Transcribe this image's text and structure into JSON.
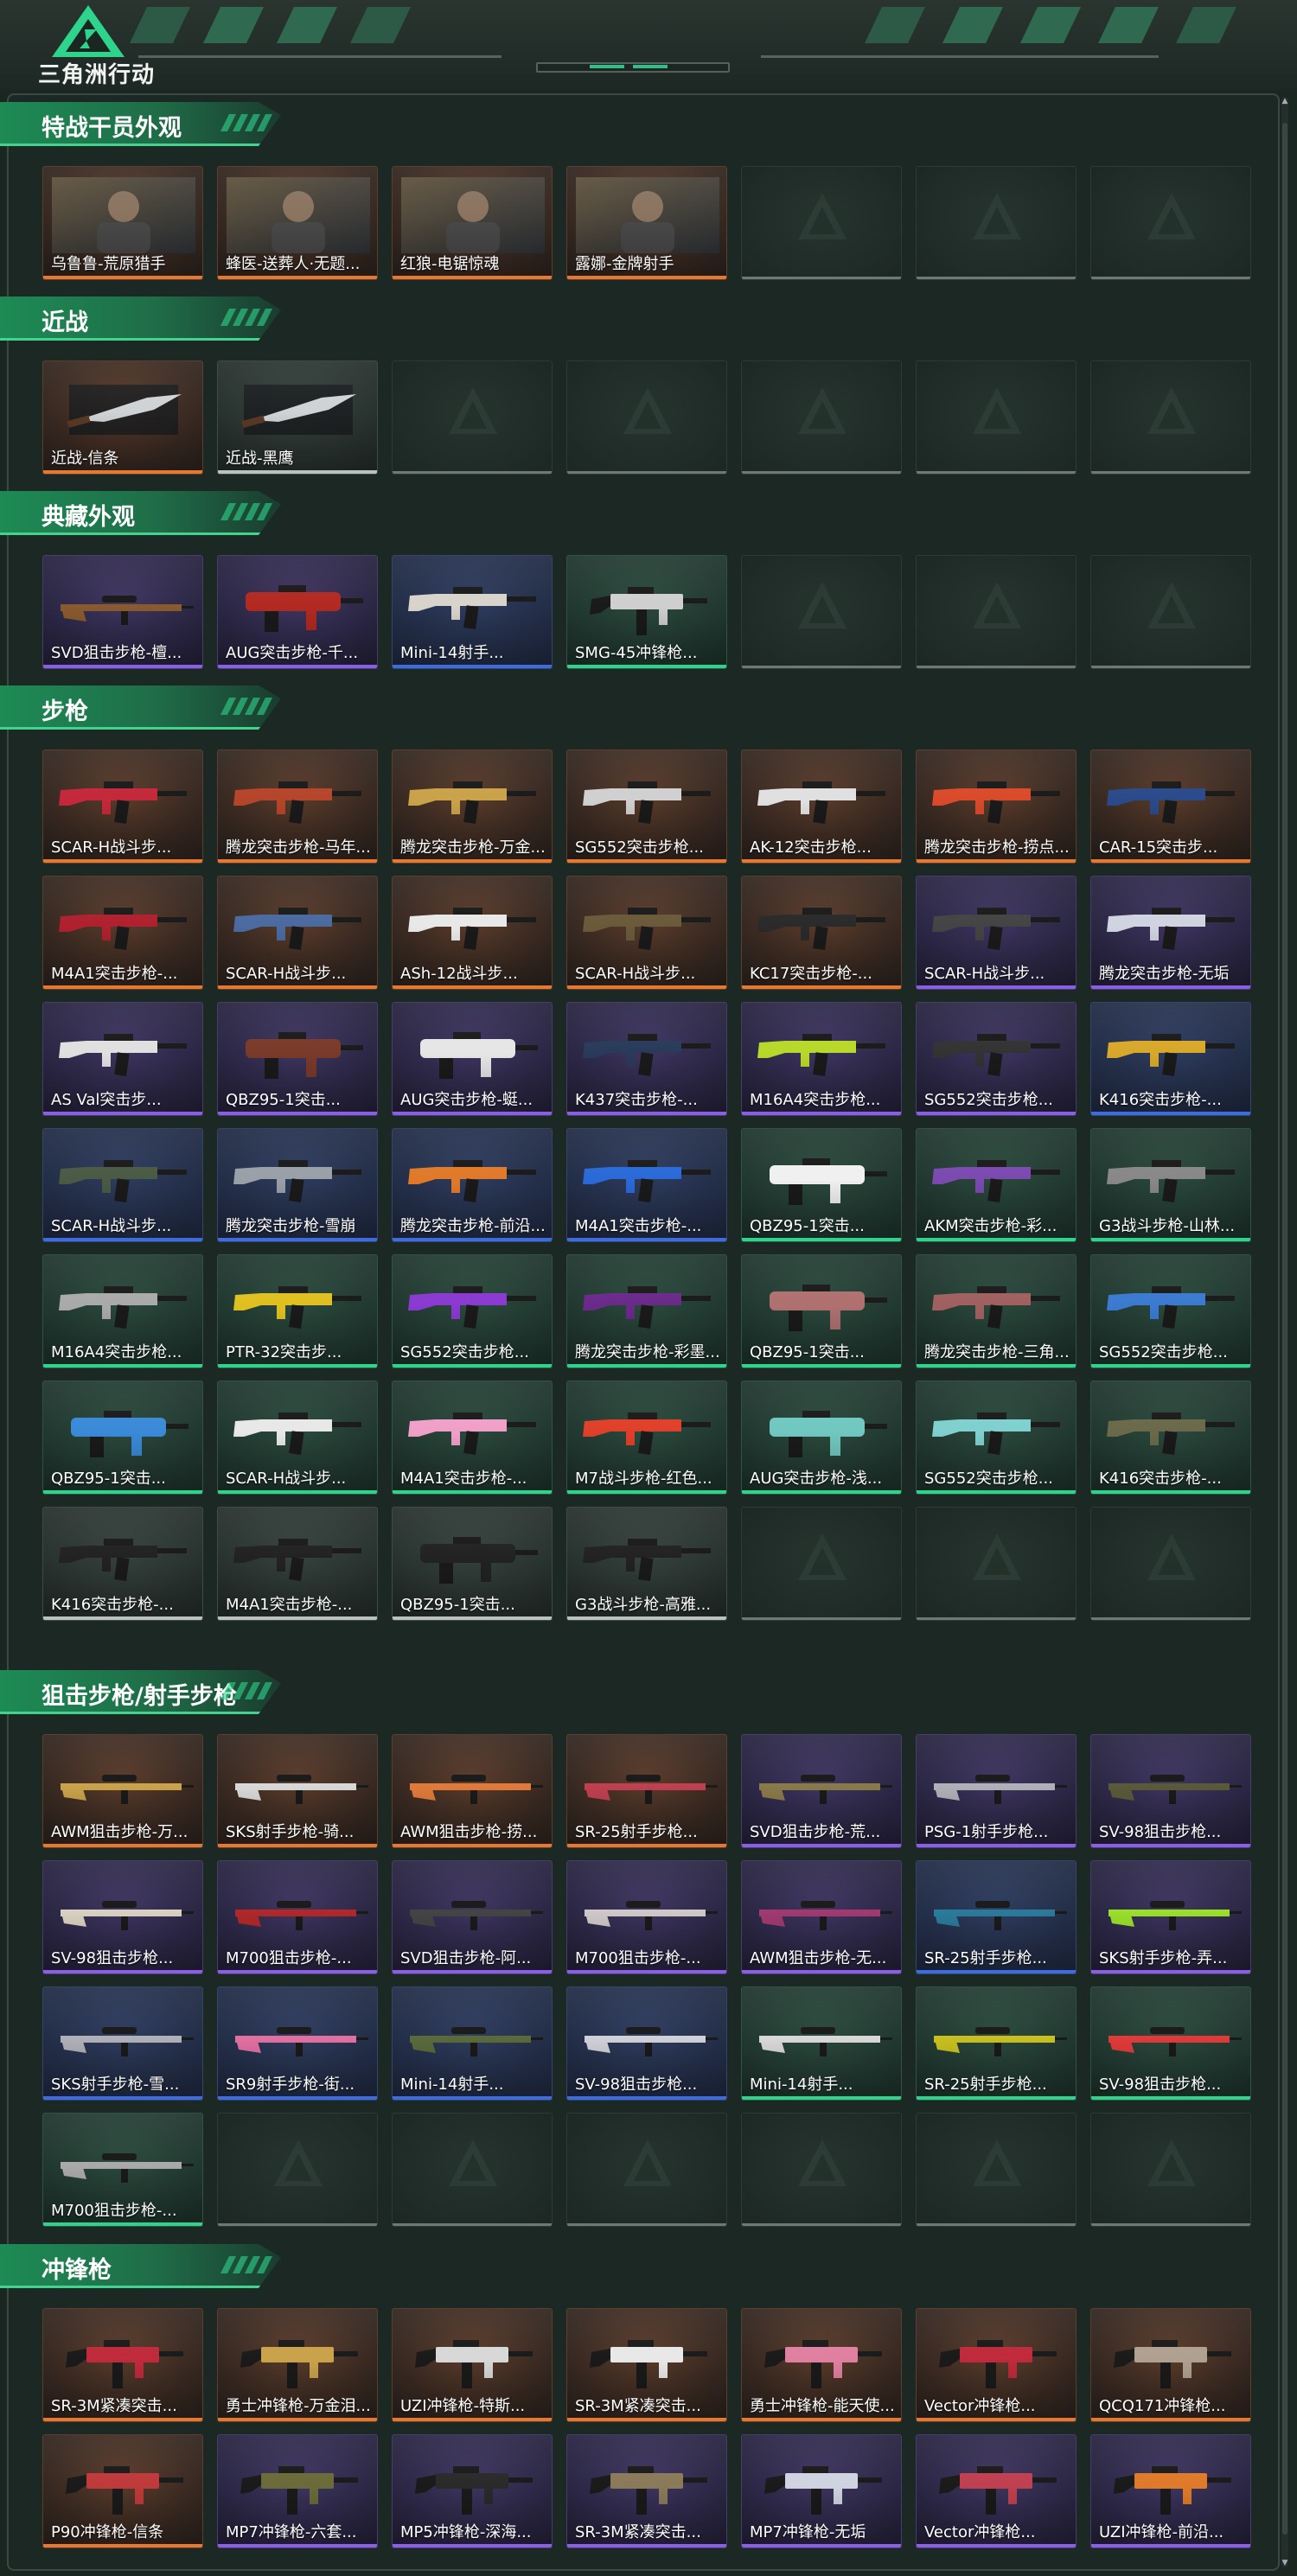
{
  "brand": "三角洲行动",
  "sections": [
    {
      "title": "特战干员外观",
      "items": [
        {
          "label": "乌鲁鲁-荒原猎手",
          "rarity": "orange",
          "kind": "portrait"
        },
        {
          "label": "蜂医-送葬人·无题...",
          "rarity": "orange",
          "kind": "portrait"
        },
        {
          "label": "红狼-电锯惊魂",
          "rarity": "orange",
          "kind": "portrait"
        },
        {
          "label": "露娜-金牌射手",
          "rarity": "orange",
          "kind": "portrait"
        },
        {
          "label": "",
          "rarity": "empty"
        },
        {
          "label": "",
          "rarity": "empty"
        },
        {
          "label": "",
          "rarity": "empty"
        }
      ]
    },
    {
      "title": "近战",
      "items": [
        {
          "label": "近战-信条",
          "rarity": "orange",
          "kind": "knife"
        },
        {
          "label": "近战-黑鹰",
          "rarity": "white",
          "kind": "knife"
        },
        {
          "label": "",
          "rarity": "empty"
        },
        {
          "label": "",
          "rarity": "empty"
        },
        {
          "label": "",
          "rarity": "empty"
        },
        {
          "label": "",
          "rarity": "empty"
        },
        {
          "label": "",
          "rarity": "empty"
        }
      ]
    },
    {
      "title": "典藏外观",
      "items": [
        {
          "label": "SVD狙击步枪-檀...",
          "rarity": "purple",
          "kind": "sniper",
          "color": "#8a5a2e"
        },
        {
          "label": "AUG突击步枪-千...",
          "rarity": "purple",
          "kind": "bullpup",
          "color": "#b22a22"
        },
        {
          "label": "Mini-14射手...",
          "rarity": "blue",
          "kind": "rifle",
          "color": "#d8d4cc"
        },
        {
          "label": "SMG-45冲锋枪...",
          "rarity": "green",
          "kind": "smg",
          "color": "#cfcfcf"
        },
        {
          "label": "",
          "rarity": "empty"
        },
        {
          "label": "",
          "rarity": "empty"
        },
        {
          "label": "",
          "rarity": "empty"
        }
      ]
    },
    {
      "title": "步枪",
      "items": [
        {
          "label": "SCAR-H战斗步...",
          "rarity": "orange",
          "kind": "rifle",
          "color": "#c4283a"
        },
        {
          "label": "腾龙突击步枪-马年...",
          "rarity": "orange",
          "kind": "rifle",
          "color": "#b5452a"
        },
        {
          "label": "腾龙突击步枪-万金...",
          "rarity": "orange",
          "kind": "rifle",
          "color": "#c9a24a"
        },
        {
          "label": "SG552突击步枪...",
          "rarity": "orange",
          "kind": "rifle",
          "color": "#d0d0d0"
        },
        {
          "label": "AK-12突击步枪...",
          "rarity": "orange",
          "kind": "rifle",
          "color": "#e0e0e0"
        },
        {
          "label": "腾龙突击步枪-捞点...",
          "rarity": "orange",
          "kind": "rifle",
          "color": "#d94a2a"
        },
        {
          "label": "CAR-15突击步...",
          "rarity": "orange",
          "kind": "rifle",
          "color": "#2a4a8a"
        },
        {
          "label": "M4A1突击步枪-...",
          "rarity": "orange",
          "kind": "rifle",
          "color": "#b0202e"
        },
        {
          "label": "SCAR-H战斗步...",
          "rarity": "orange",
          "kind": "rifle",
          "color": "#4a6aa0"
        },
        {
          "label": "ASh-12战斗步...",
          "rarity": "orange",
          "kind": "rifle",
          "color": "#e8e8e8"
        },
        {
          "label": "SCAR-H战斗步...",
          "rarity": "orange",
          "kind": "rifle",
          "color": "#6a5a3a"
        },
        {
          "label": "KC17突击步枪-...",
          "rarity": "orange",
          "kind": "rifle",
          "color": "#2a2a2a"
        },
        {
          "label": "SCAR-H战斗步...",
          "rarity": "purple",
          "kind": "rifle",
          "color": "#444444"
        },
        {
          "label": "腾龙突击步枪-无垢",
          "rarity": "purple",
          "kind": "rifle",
          "color": "#d0d4e0"
        },
        {
          "label": "AS Val突击步...",
          "rarity": "purple",
          "kind": "rifle",
          "color": "#e0e0e0"
        },
        {
          "label": "QBZ95-1突击...",
          "rarity": "purple",
          "kind": "bullpup",
          "color": "#7a3a2a"
        },
        {
          "label": "AUG突击步枪-蜓...",
          "rarity": "purple",
          "kind": "bullpup",
          "color": "#e6e6e6"
        },
        {
          "label": "K437突击步枪-...",
          "rarity": "purple",
          "kind": "rifle",
          "color": "#2a3a5a"
        },
        {
          "label": "M16A4突击步枪...",
          "rarity": "purple",
          "kind": "rifle",
          "color": "#b8d82a"
        },
        {
          "label": "SG552突击步枪...",
          "rarity": "purple",
          "kind": "rifle",
          "color": "#333333"
        },
        {
          "label": "K416突击步枪-...",
          "rarity": "blue",
          "kind": "rifle",
          "color": "#d8a82a"
        },
        {
          "label": "SCAR-H战斗步...",
          "rarity": "blue",
          "kind": "rifle",
          "color": "#4a5a44"
        },
        {
          "label": "腾龙突击步枪-雪崩",
          "rarity": "blue",
          "kind": "rifle",
          "color": "#9aa0a8"
        },
        {
          "label": "腾龙突击步枪-前沿...",
          "rarity": "blue",
          "kind": "rifle",
          "color": "#e07a2a"
        },
        {
          "label": "M4A1突击步枪-...",
          "rarity": "blue",
          "kind": "rifle",
          "color": "#2a6ad8"
        },
        {
          "label": "QBZ95-1突击...",
          "rarity": "green",
          "kind": "bullpup",
          "color": "#f0f0f0"
        },
        {
          "label": "AKM突击步枪-彩...",
          "rarity": "green",
          "kind": "rifle",
          "color": "#7a4ab0"
        },
        {
          "label": "G3战斗步枪-山林...",
          "rarity": "green",
          "kind": "rifle",
          "color": "#888888"
        },
        {
          "label": "M16A4突击步枪...",
          "rarity": "green",
          "kind": "rifle",
          "color": "#aaaaaa"
        },
        {
          "label": "PTR-32突击步...",
          "rarity": "green",
          "kind": "rifle",
          "color": "#e0c020"
        },
        {
          "label": "SG552突击步枪...",
          "rarity": "green",
          "kind": "rifle",
          "color": "#8a3ad0"
        },
        {
          "label": "腾龙突击步枪-彩墨...",
          "rarity": "green",
          "kind": "rifle",
          "color": "#6a2a8a"
        },
        {
          "label": "QBZ95-1突击...",
          "rarity": "green",
          "kind": "bullpup",
          "color": "#b07070"
        },
        {
          "label": "腾龙突击步枪-三角...",
          "rarity": "green",
          "kind": "rifle",
          "color": "#a06060"
        },
        {
          "label": "SG552突击步枪...",
          "rarity": "green",
          "kind": "rifle",
          "color": "#3a7ad0"
        },
        {
          "label": "QBZ95-1突击...",
          "rarity": "green",
          "kind": "bullpup",
          "color": "#3a8ad8"
        },
        {
          "label": "SCAR-H战斗步...",
          "rarity": "green",
          "kind": "rifle",
          "color": "#e8e8e8"
        },
        {
          "label": "M4A1突击步枪-...",
          "rarity": "green",
          "kind": "rifle",
          "color": "#f0a0c8"
        },
        {
          "label": "M7战斗步枪-红色...",
          "rarity": "green",
          "kind": "rifle",
          "color": "#e0402a"
        },
        {
          "label": "AUG突击步枪-浅...",
          "rarity": "green",
          "kind": "bullpup",
          "color": "#70c8c0"
        },
        {
          "label": "SG552突击步枪...",
          "rarity": "green",
          "kind": "rifle",
          "color": "#80d0d0"
        },
        {
          "label": "K416突击步枪-...",
          "rarity": "green",
          "kind": "rifle",
          "color": "#6a6a4a"
        },
        {
          "label": "K416突击步枪-...",
          "rarity": "white",
          "kind": "rifle",
          "color": "#222222"
        },
        {
          "label": "M4A1突击步枪-...",
          "rarity": "white",
          "kind": "rifle",
          "color": "#222222"
        },
        {
          "label": "QBZ95-1突击...",
          "rarity": "white",
          "kind": "bullpup",
          "color": "#222222"
        },
        {
          "label": "G3战斗步枪-高雅...",
          "rarity": "white",
          "kind": "rifle",
          "color": "#222222"
        },
        {
          "label": "",
          "rarity": "empty"
        },
        {
          "label": "",
          "rarity": "empty"
        },
        {
          "label": "",
          "rarity": "empty"
        }
      ]
    },
    {
      "title": "狙击步枪/射手步枪",
      "items": [
        {
          "label": "AWM狙击步枪-万...",
          "rarity": "orange",
          "kind": "sniper",
          "color": "#c9a24a"
        },
        {
          "label": "SKS射手步枪-骑...",
          "rarity": "orange",
          "kind": "sniper",
          "color": "#d8d8d8"
        },
        {
          "label": "AWM狙击步枪-捞...",
          "rarity": "orange",
          "kind": "sniper",
          "color": "#e07a3a"
        },
        {
          "label": "SR-25射手步枪...",
          "rarity": "orange",
          "kind": "sniper",
          "color": "#c04050"
        },
        {
          "label": "SVD狙击步枪-荒...",
          "rarity": "purple",
          "kind": "sniper",
          "color": "#8a7a4a"
        },
        {
          "label": "PSG-1射手步枪...",
          "rarity": "purple",
          "kind": "sniper",
          "color": "#b0b0b8"
        },
        {
          "label": "SV-98狙击步枪...",
          "rarity": "purple",
          "kind": "sniper",
          "color": "#5a5a3a"
        },
        {
          "label": "SV-98狙击步枪...",
          "rarity": "purple",
          "kind": "sniper",
          "color": "#d8d0c0"
        },
        {
          "label": "M700狙击步枪-...",
          "rarity": "purple",
          "kind": "sniper",
          "color": "#b0282a"
        },
        {
          "label": "SVD狙击步枪-阿...",
          "rarity": "purple",
          "kind": "sniper",
          "color": "#444444"
        },
        {
          "label": "M700狙击步枪-...",
          "rarity": "purple",
          "kind": "sniper",
          "color": "#d0c8c8"
        },
        {
          "label": "AWM狙击步枪-无...",
          "rarity": "purple",
          "kind": "sniper",
          "color": "#a03a70"
        },
        {
          "label": "SR-25射手步枪...",
          "rarity": "blue",
          "kind": "sniper",
          "color": "#2a7a9a"
        },
        {
          "label": "SKS射手步枪-弄...",
          "rarity": "purple",
          "kind": "sniper",
          "color": "#9adf2a"
        },
        {
          "label": "SKS射手步枪-雪...",
          "rarity": "blue",
          "kind": "sniper",
          "color": "#b0b0b8"
        },
        {
          "label": "SR9射手步枪-街...",
          "rarity": "blue",
          "kind": "sniper",
          "color": "#e070a0"
        },
        {
          "label": "Mini-14射手...",
          "rarity": "blue",
          "kind": "sniper",
          "color": "#5a6a3a"
        },
        {
          "label": "SV-98狙击步枪...",
          "rarity": "blue",
          "kind": "sniper",
          "color": "#d0d0d8"
        },
        {
          "label": "Mini-14射手...",
          "rarity": "green",
          "kind": "sniper",
          "color": "#d8d8d8"
        },
        {
          "label": "SR-25射手步枪...",
          "rarity": "green",
          "kind": "sniper",
          "color": "#c8c020"
        },
        {
          "label": "SV-98狙击步枪...",
          "rarity": "green",
          "kind": "sniper",
          "color": "#e03a3a"
        },
        {
          "label": "M700狙击步枪-...",
          "rarity": "green",
          "kind": "sniper",
          "color": "#aaaaaa"
        },
        {
          "label": "",
          "rarity": "empty"
        },
        {
          "label": "",
          "rarity": "empty"
        },
        {
          "label": "",
          "rarity": "empty"
        },
        {
          "label": "",
          "rarity": "empty"
        },
        {
          "label": "",
          "rarity": "empty"
        },
        {
          "label": "",
          "rarity": "empty"
        }
      ]
    },
    {
      "title": "冲锋枪",
      "items": [
        {
          "label": "SR-3M紧凑突击...",
          "rarity": "orange",
          "kind": "smg",
          "color": "#c02a3a"
        },
        {
          "label": "勇士冲锋枪-万金泪...",
          "rarity": "orange",
          "kind": "smg",
          "color": "#c9a24a"
        },
        {
          "label": "UZI冲锋枪-特斯...",
          "rarity": "orange",
          "kind": "smg",
          "color": "#d8d8d8"
        },
        {
          "label": "SR-3M紧凑突击...",
          "rarity": "orange",
          "kind": "smg",
          "color": "#e8e8e8"
        },
        {
          "label": "勇士冲锋枪-能天使...",
          "rarity": "orange",
          "kind": "smg",
          "color": "#e080a0"
        },
        {
          "label": "Vector冲锋枪...",
          "rarity": "orange",
          "kind": "smg",
          "color": "#c02a3a"
        },
        {
          "label": "QCQ171冲锋枪...",
          "rarity": "orange",
          "kind": "smg",
          "color": "#b0a090"
        },
        {
          "label": "P90冲锋枪-信条",
          "rarity": "orange",
          "kind": "smg",
          "color": "#c03a3a"
        },
        {
          "label": "MP7冲锋枪-六套...",
          "rarity": "purple",
          "kind": "smg",
          "color": "#6a6a3a"
        },
        {
          "label": "MP5冲锋枪-深海...",
          "rarity": "purple",
          "kind": "smg",
          "color": "#2a2a2a"
        },
        {
          "label": "SR-3M紧凑突击...",
          "rarity": "purple",
          "kind": "smg",
          "color": "#8a7a5a"
        },
        {
          "label": "MP7冲锋枪-无垢",
          "rarity": "purple",
          "kind": "smg",
          "color": "#d0d4e0"
        },
        {
          "label": "Vector冲锋枪...",
          "rarity": "purple",
          "kind": "smg",
          "color": "#c04050"
        },
        {
          "label": "UZI冲锋枪-前沿...",
          "rarity": "purple",
          "kind": "smg",
          "color": "#e07a2a"
        }
      ]
    }
  ]
}
